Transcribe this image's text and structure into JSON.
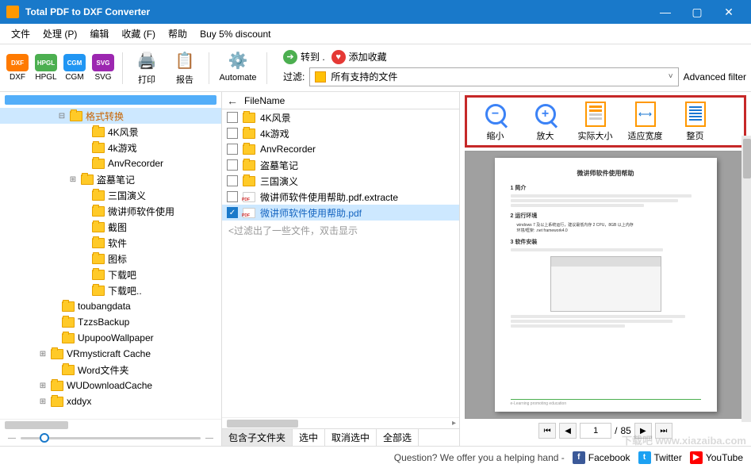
{
  "app": {
    "title": "Total PDF to DXF Converter"
  },
  "window_controls": {
    "min": "—",
    "max": "▢",
    "close": "✕"
  },
  "menu": {
    "file": "文件",
    "process": "处理 (P)",
    "edit": "编辑",
    "favorites": "收藏 (F)",
    "help": "帮助",
    "discount": "Buy 5% discount"
  },
  "toolbar": {
    "formats": {
      "dxf": "DXF",
      "hpgl": "HPGL",
      "cgm": "CGM",
      "svg": "SVG"
    },
    "print": "打印",
    "report": "报告",
    "automate": "Automate",
    "goto": "转到 .",
    "add_fav": "添加收藏",
    "filter_label": "过滤:",
    "filter_value": "所有支持的文件",
    "advanced_filter": "Advanced filter"
  },
  "tree": {
    "selected": "格式转换",
    "items": [
      {
        "pad": 100,
        "exp": "",
        "label": "4K风景"
      },
      {
        "pad": 100,
        "exp": "",
        "label": "4k游戏"
      },
      {
        "pad": 100,
        "exp": "",
        "label": "AnvRecorder"
      },
      {
        "pad": 86,
        "exp": "⊞",
        "label": "盗墓笔记"
      },
      {
        "pad": 100,
        "exp": "",
        "label": "三国演义"
      },
      {
        "pad": 100,
        "exp": "",
        "label": "微讲师软件使用"
      },
      {
        "pad": 100,
        "exp": "",
        "label": "截图"
      },
      {
        "pad": 100,
        "exp": "",
        "label": "软件"
      },
      {
        "pad": 100,
        "exp": "",
        "label": "图标"
      },
      {
        "pad": 100,
        "exp": "",
        "label": "下载吧"
      },
      {
        "pad": 100,
        "exp": "",
        "label": "下载吧.."
      },
      {
        "pad": 62,
        "exp": "",
        "label": "toubangdata"
      },
      {
        "pad": 62,
        "exp": "",
        "label": "TzzsBackup"
      },
      {
        "pad": 62,
        "exp": "",
        "label": "UpupooWallpaper"
      },
      {
        "pad": 48,
        "exp": "⊞",
        "label": "VRmysticraft Cache"
      },
      {
        "pad": 62,
        "exp": "",
        "label": "Word文件夹"
      },
      {
        "pad": 48,
        "exp": "⊞",
        "label": "WUDownloadCache"
      },
      {
        "pad": 48,
        "exp": "⊞",
        "label": "xddyx"
      }
    ]
  },
  "filelist": {
    "header_col": "FileName",
    "rows": [
      {
        "checked": false,
        "type": "folder",
        "name": "4K风景"
      },
      {
        "checked": false,
        "type": "folder",
        "name": "4k游戏"
      },
      {
        "checked": false,
        "type": "folder",
        "name": "AnvRecorder"
      },
      {
        "checked": false,
        "type": "folder",
        "name": "盗墓笔记"
      },
      {
        "checked": false,
        "type": "folder",
        "name": "三国演义"
      },
      {
        "checked": false,
        "type": "pdf",
        "name": "微讲师软件使用帮助.pdf.extracte"
      },
      {
        "checked": true,
        "type": "pdf",
        "name": "微讲师软件使用帮助.pdf",
        "selected": true
      }
    ],
    "filter_msg": "<过滤出了一些文件，双击显示",
    "bottom": {
      "subfolders": "包含子文件夹",
      "select": "选中",
      "deselect": "取消选中",
      "all": "全部选"
    }
  },
  "preview_toolbar": {
    "zoomout": "缩小",
    "zoomin": "放大",
    "actual": "实际大小",
    "fitw": "适应宽度",
    "whole": "整页"
  },
  "preview_nav": {
    "page": "1",
    "of_label": "/",
    "total": "85"
  },
  "preview_doc": {
    "title": "微讲师软件使用帮助",
    "s1": "1  简介",
    "s2": "2  运行环境",
    "s2a": "windows 7 及以上系统运行，建议最低内存 2 CPU，8GB 以上内存",
    "s2b": "环境/框架: .net framework4.0",
    "s3": "3  软件安装",
    "footer": "e-Learning promoting education"
  },
  "status": {
    "help": "Question? We offer you a helping hand  -",
    "facebook": "Facebook",
    "twitter": "Twitter",
    "youtube": "YouTube"
  },
  "watermark": "下载吧 www.xiazaiba.com"
}
